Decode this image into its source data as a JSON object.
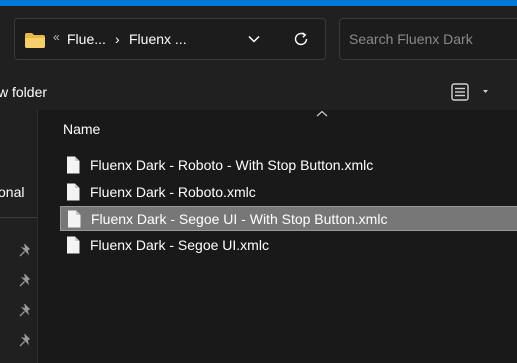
{
  "colors": {
    "accent": "#0078d4",
    "background": "#191919",
    "selection": "#777777"
  },
  "address_bar": {
    "crumbs": [
      "Flue...",
      "Fluenx ..."
    ],
    "overflow_glyph": "«",
    "separator": "›",
    "icons": [
      "folder-icon",
      "chevron-down-icon",
      "refresh-icon"
    ]
  },
  "search": {
    "placeholder": "Search Fluenx Dark"
  },
  "command_bar": {
    "new_folder_label": "w folder",
    "view_icon": "details-view-icon"
  },
  "nav_pane": {
    "partial_label": "onal",
    "pin_icon_count": 4
  },
  "file_list": {
    "column_header": "Name",
    "files": [
      {
        "name": "Fluenx Dark - Roboto - With Stop Button.xmlc",
        "selected": false
      },
      {
        "name": "Fluenx Dark - Roboto.xmlc",
        "selected": false
      },
      {
        "name": "Fluenx Dark - Segoe UI - With Stop Button.xmlc",
        "selected": true
      },
      {
        "name": "Fluenx Dark - Segoe UI.xmlc",
        "selected": false
      }
    ]
  }
}
